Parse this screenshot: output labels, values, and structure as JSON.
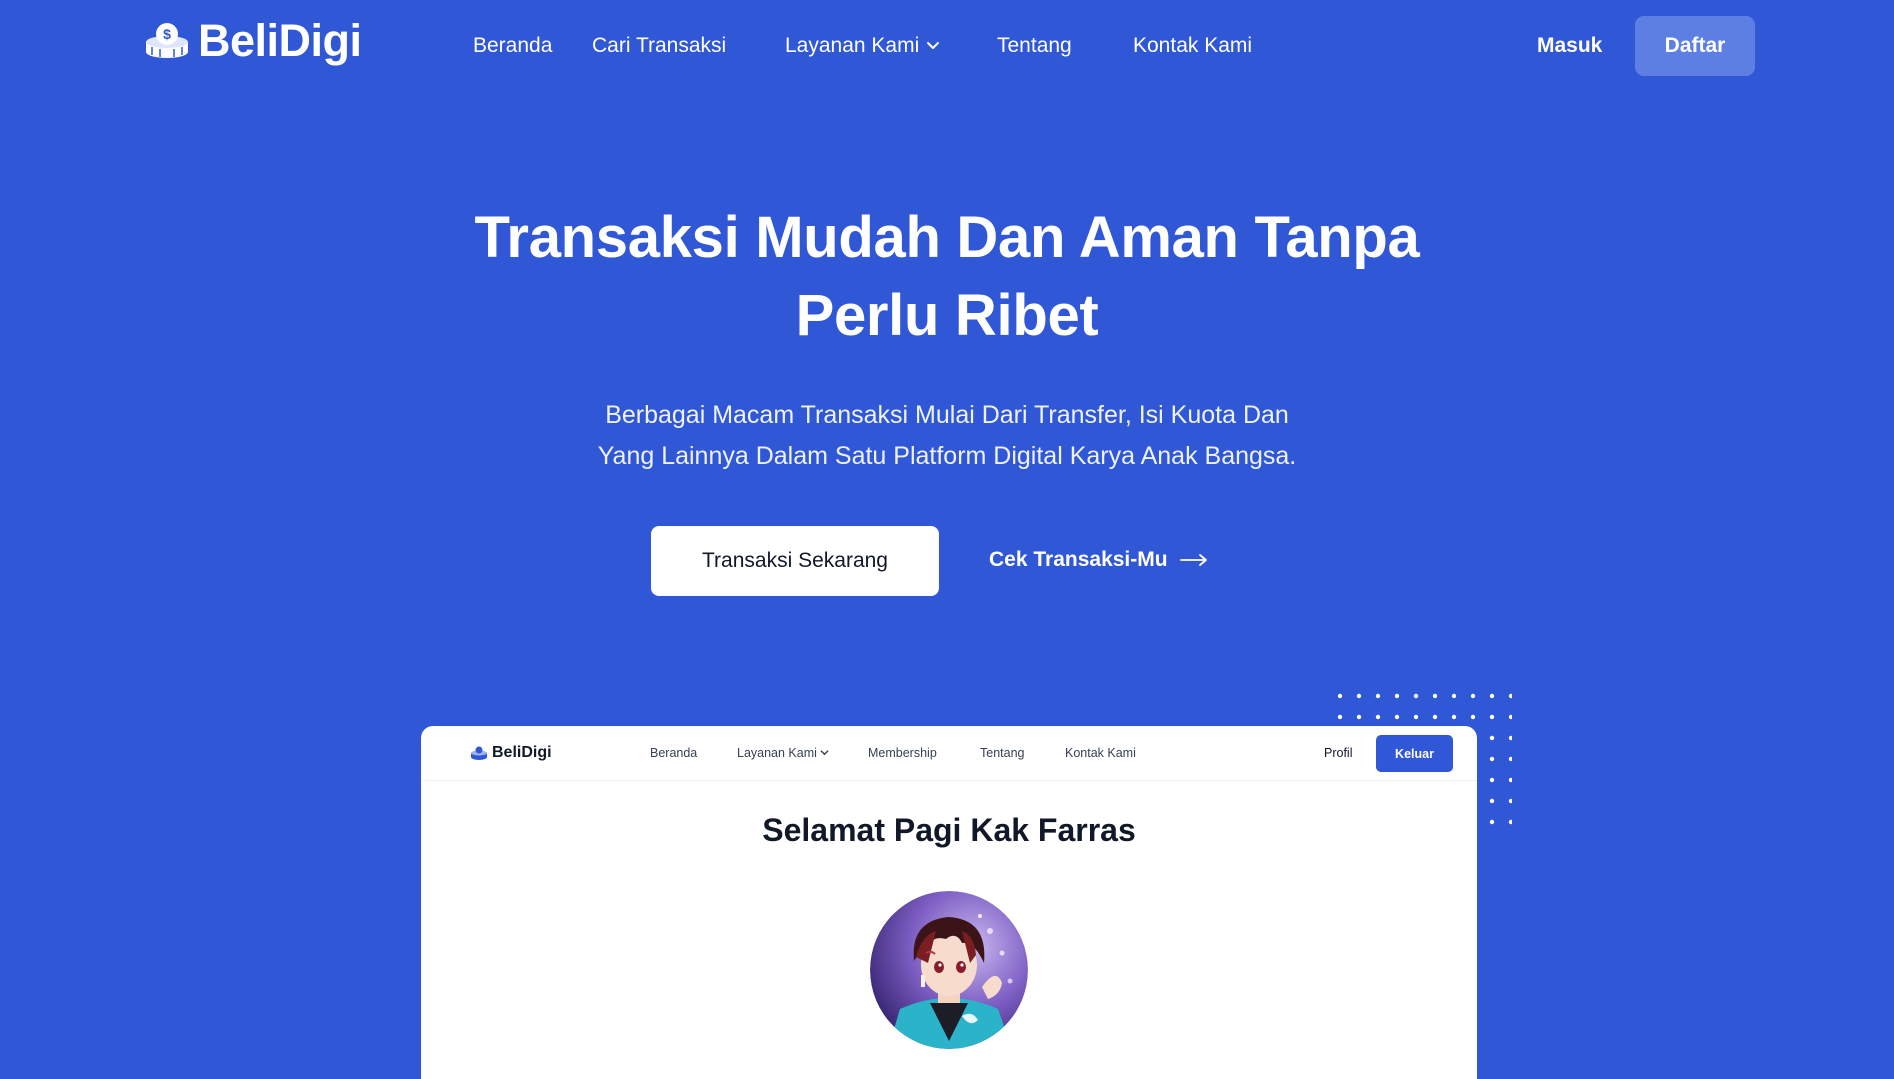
{
  "brand": {
    "name": "BeliDigi",
    "logo_icon": "coin-stack-dollar-icon"
  },
  "nav": {
    "items": [
      {
        "label": "Beranda"
      },
      {
        "label": "Cari Transaksi"
      },
      {
        "label": "Layanan Kami",
        "icon": "chevron-down-icon"
      },
      {
        "label": "Tentang"
      },
      {
        "label": "Kontak Kami"
      }
    ],
    "login_label": "Masuk",
    "register_label": "Daftar"
  },
  "hero": {
    "title_line1": "Transaksi Mudah Dan Aman Tanpa",
    "title_line2": "Perlu Ribet",
    "subtitle_line1": "Berbagai Macam Transaksi Mulai Dari Transfer, Isi Kuota Dan",
    "subtitle_line2": "Yang Lainnya Dalam Satu Platform Digital Karya Anak Bangsa.",
    "primary_cta": "Transaksi Sekarang",
    "secondary_cta": "Cek Transaksi-Mu",
    "secondary_icon": "arrow-right-icon"
  },
  "preview": {
    "brand": "BeliDigi",
    "nav_items": [
      {
        "label": "Beranda"
      },
      {
        "label": "Layanan Kami",
        "icon": "chevron-down-icon"
      },
      {
        "label": "Membership"
      },
      {
        "label": "Tentang"
      },
      {
        "label": "Kontak Kami"
      }
    ],
    "profile_label": "Profil",
    "logout_label": "Keluar",
    "greeting": "Selamat Pagi Kak Farras",
    "avatar_icon": "anime-avatar-image"
  },
  "colors": {
    "background": "#3057d5",
    "register_button": "#5d7fe3",
    "card": "#ffffff",
    "logout_button": "#3057d5",
    "heading_dark": "#111827"
  }
}
